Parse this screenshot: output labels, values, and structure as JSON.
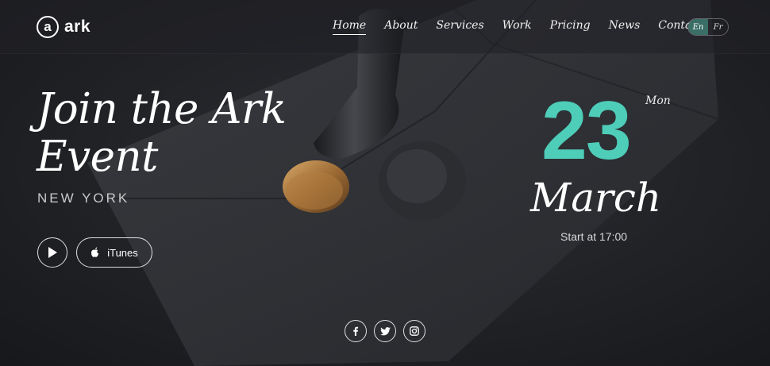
{
  "brand": {
    "logo_letter": "a",
    "name": "ark"
  },
  "nav": {
    "items": [
      {
        "label": "Home",
        "active": true
      },
      {
        "label": "About"
      },
      {
        "label": "Services"
      },
      {
        "label": "Work"
      },
      {
        "label": "Pricing"
      },
      {
        "label": "News"
      },
      {
        "label": "Contacts"
      }
    ]
  },
  "language": {
    "options": [
      "En",
      "Fr"
    ],
    "selected": "En"
  },
  "hero": {
    "title_line1": "Join the Ark",
    "title_line2": "Event",
    "location": "NEW YORK",
    "itunes_label": "iTunes"
  },
  "event_date": {
    "day": "23",
    "weekday": "Mon",
    "month": "March",
    "start_text": "Start at 17:00"
  },
  "socials": [
    {
      "icon": "facebook-icon"
    },
    {
      "icon": "twitter-icon"
    },
    {
      "icon": "instagram-icon"
    }
  ],
  "colors": {
    "accent": "#4ecdb9",
    "lang_active": "#3a6e66",
    "background": "#1c1d21"
  }
}
